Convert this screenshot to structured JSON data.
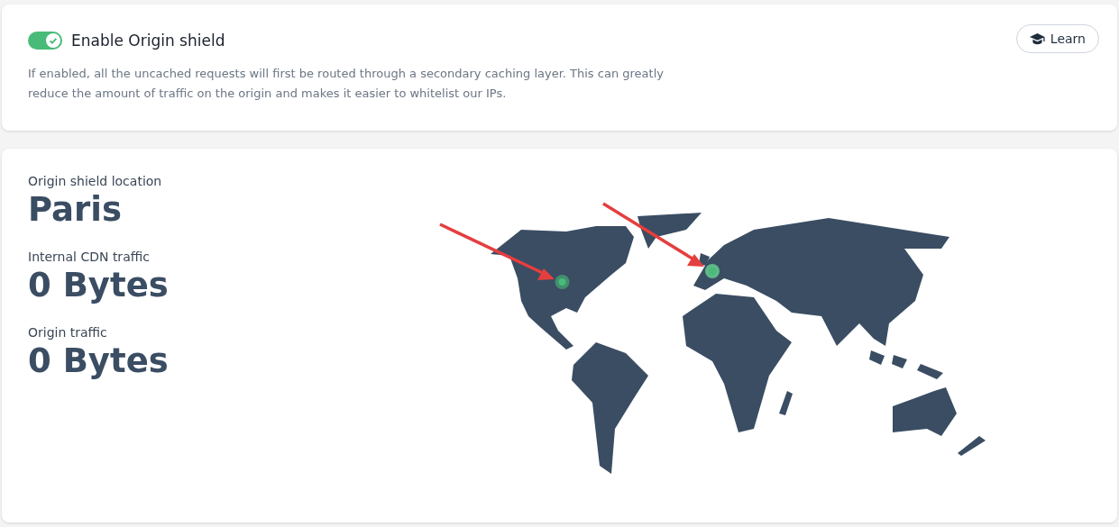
{
  "origin_shield": {
    "toggle": {
      "label": "Enable Origin shield",
      "checked": true
    },
    "description": "If enabled, all the uncached requests will first be routed through a secondary caching layer. This can greatly reduce the amount of traffic on the origin and makes it easier to whitelist our IPs.",
    "learn_button": "Learn"
  },
  "stats": [
    {
      "label": "Origin shield location",
      "value": "Paris"
    },
    {
      "label": "Internal CDN traffic",
      "value": "0 Bytes"
    },
    {
      "label": "Origin traffic",
      "value": "0 Bytes"
    }
  ]
}
